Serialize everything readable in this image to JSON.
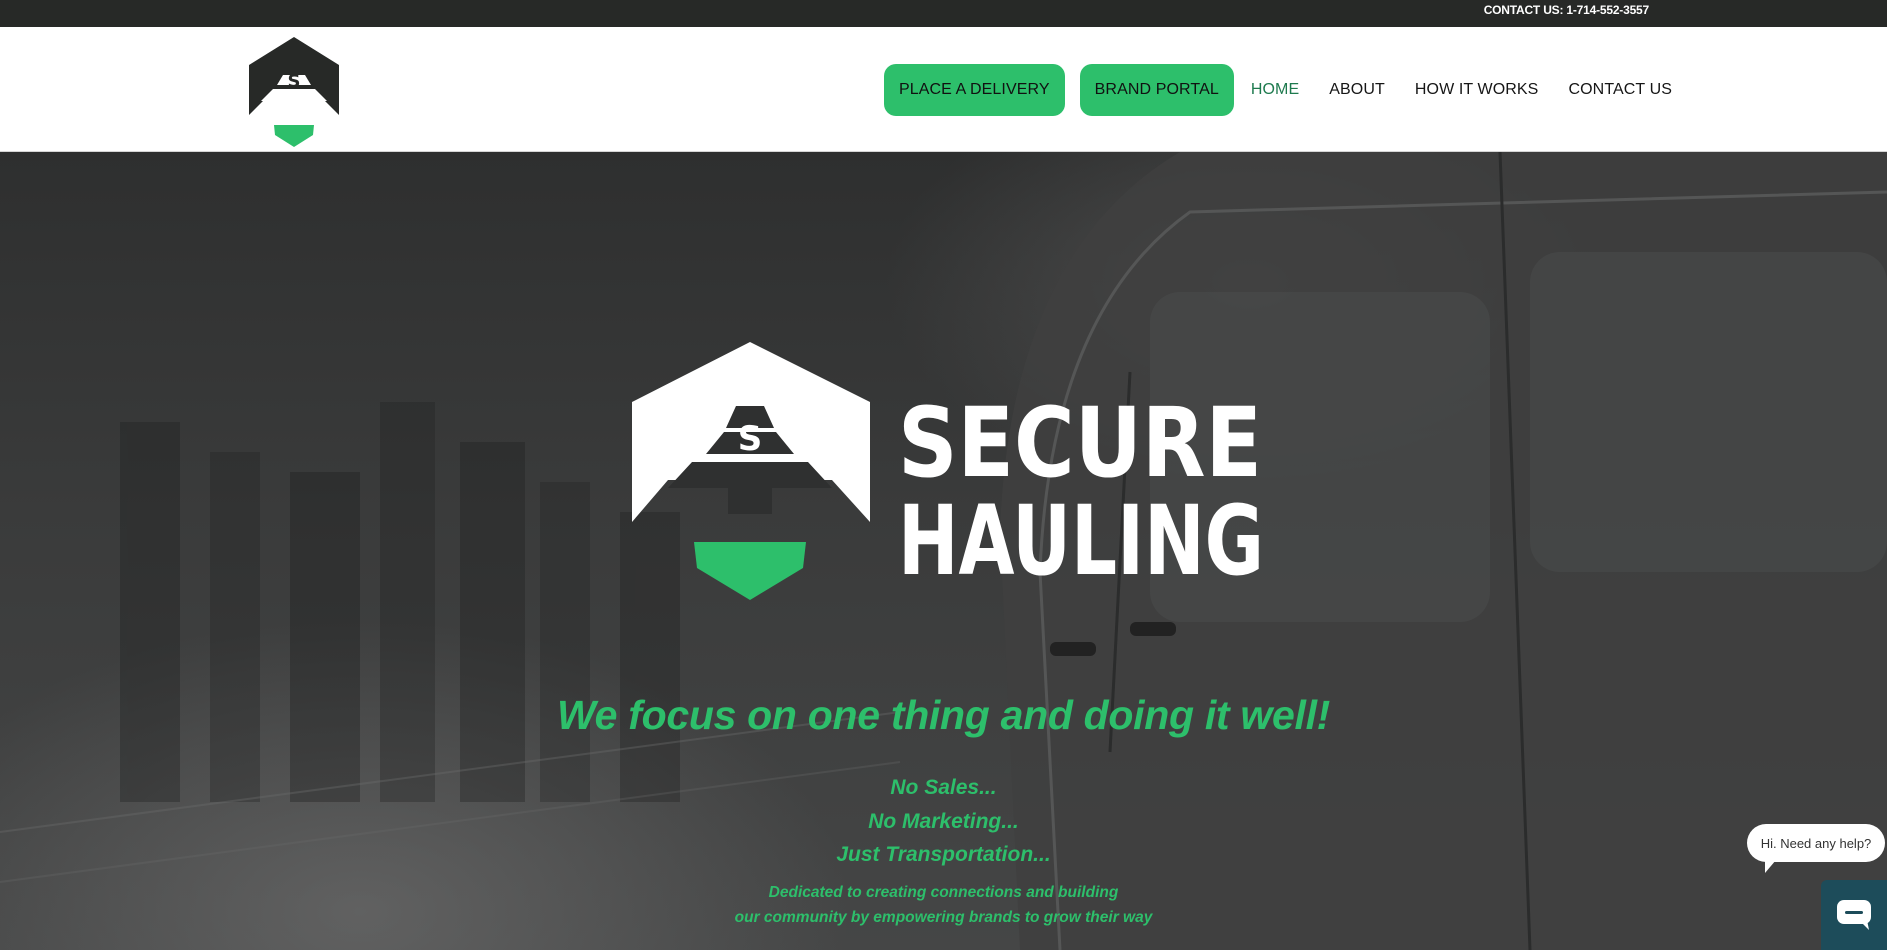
{
  "topbar": {
    "contact": "CONTACT US: 1-714-552-3557"
  },
  "header": {
    "logo": "secure-hauling-shield-logo",
    "nav": {
      "place_delivery": "PLACE A DELIVERY",
      "brand_portal": "BRAND PORTAL",
      "home": "HOME",
      "about": "ABOUT",
      "how_it_works": "HOW IT WORKS",
      "contact": "CONTACT US"
    }
  },
  "hero": {
    "brand_line1": "SECURE",
    "brand_line2": "HAULING",
    "tagline": "We focus on one thing and doing it well!",
    "points": [
      "No Sales...",
      "No Marketing...",
      "Just Transportation..."
    ],
    "mission": [
      "Dedicated to creating connections and building",
      "our community by empowering brands to grow their way"
    ]
  },
  "chat": {
    "greeting": "Hi. Need any help?",
    "icon": "chat-icon"
  },
  "colors": {
    "accent": "#2dbf6b",
    "topbar": "#272927",
    "chat_button": "#1d4c5a"
  }
}
